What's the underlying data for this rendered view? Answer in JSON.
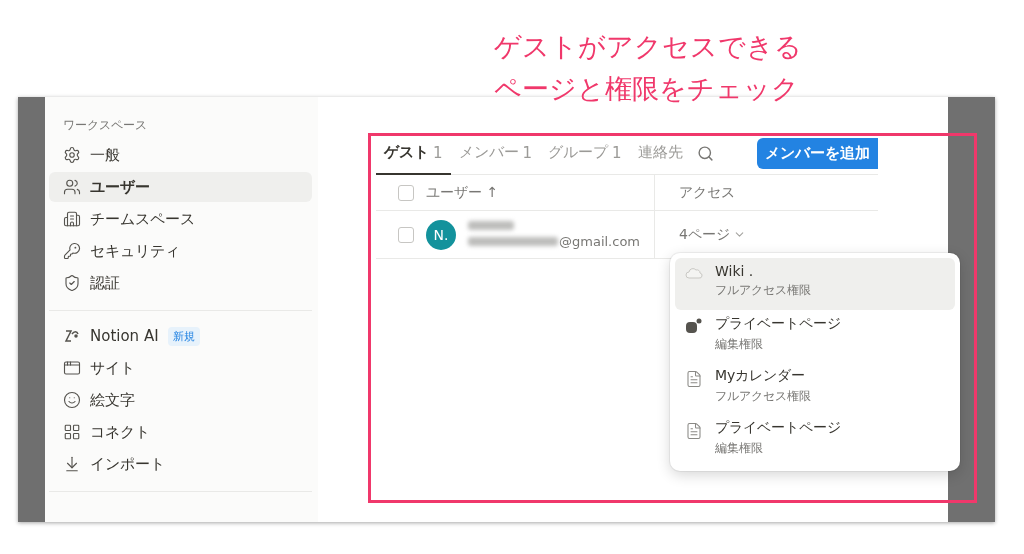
{
  "annotation": [
    "ゲストがアクセスできる",
    "ページと権限をチェック"
  ],
  "sidebar": {
    "heading": "ワークスペース",
    "groups": [
      [
        {
          "label": "一般",
          "selected": false
        },
        {
          "label": "ユーザー",
          "selected": true
        },
        {
          "label": "チームスペース",
          "selected": false
        },
        {
          "label": "セキュリティ",
          "selected": false
        },
        {
          "label": "認証",
          "selected": false
        }
      ],
      [
        {
          "label": "Notion AI",
          "selected": false,
          "badge": "新規"
        },
        {
          "label": "サイト",
          "selected": false
        },
        {
          "label": "絵文字",
          "selected": false
        },
        {
          "label": "コネクト",
          "selected": false
        },
        {
          "label": "インポート",
          "selected": false
        }
      ]
    ]
  },
  "tabs": [
    {
      "label": "ゲスト",
      "count": "1",
      "selected": true
    },
    {
      "label": "メンバー",
      "count": "1",
      "selected": false
    },
    {
      "label": "グループ",
      "count": "1",
      "selected": false
    },
    {
      "label": "連絡先",
      "selected": false
    }
  ],
  "add_button": "メンバーを追加",
  "table": {
    "header_checked": false,
    "columns": [
      {
        "label": "ユーザー",
        "sort": "↑"
      },
      {
        "label": "アクセス"
      }
    ],
    "rows": [
      {
        "checked": false,
        "initial": "N.",
        "email": "@gmail.com",
        "access": "4ページ"
      }
    ]
  },
  "access_menu": [
    {
      "kind": "wiki",
      "title": "Wiki .",
      "permission": "フルアクセス権限",
      "selected": true
    },
    {
      "kind": "private",
      "title": "プライベートページ",
      "permission": "編集権限",
      "selected": false
    },
    {
      "kind": "page",
      "title": "Myカレンダー",
      "permission": "フルアクセス権限",
      "selected": false
    },
    {
      "kind": "page",
      "title": "プライベートページ",
      "permission": "編集権限",
      "selected": false
    }
  ]
}
